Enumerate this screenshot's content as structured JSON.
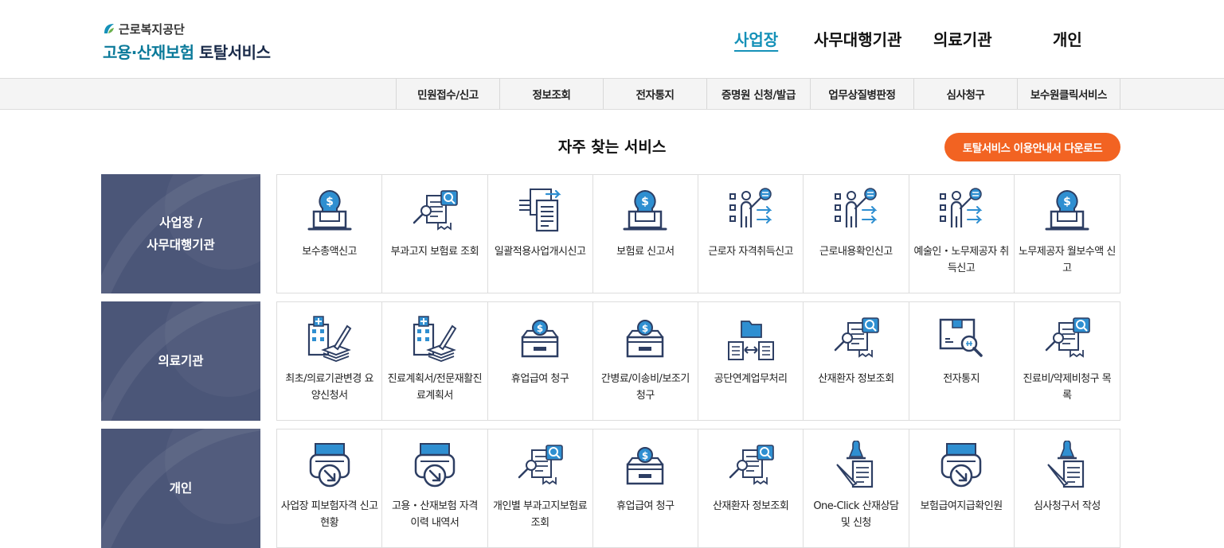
{
  "header": {
    "org": "근로복지공단",
    "title_part1": "고용·산재보험",
    "title_part2": "토탈서비스",
    "nav": [
      {
        "label": "사업장",
        "active": true
      },
      {
        "label": "사무대행기관",
        "active": false
      },
      {
        "label": "의료기관",
        "active": false
      },
      {
        "label": "개인",
        "active": false
      }
    ]
  },
  "subnav": [
    "민원접수/신고",
    "정보조회",
    "전자통지",
    "증명원 신청/발급",
    "업무상질병판정",
    "심사청구",
    "보수원클릭서비스"
  ],
  "section_title": "자주 찾는 서비스",
  "download_label": "토탈서비스 이용안내서 다운로드",
  "colors": {
    "accent": "#1591b8",
    "brand_dark": "#1a2b4a",
    "orange": "#f26322",
    "label_bg": "#4b5678",
    "icon_navy": "#2d3e63",
    "icon_blue": "#2f8fd1"
  },
  "rows": [
    {
      "label_line1": "사업장 /",
      "label_line2": "사무대행기관",
      "items": [
        {
          "label": "보수총액신고",
          "icon": "money-laptop-icon"
        },
        {
          "label": "부과고지 보험료 조회",
          "icon": "document-search-icon"
        },
        {
          "label": "일괄적용사업개시신고",
          "icon": "document-transfer-icon"
        },
        {
          "label": "보험료 신고서",
          "icon": "money-laptop-icon"
        },
        {
          "label": "근로자 자격취득신고",
          "icon": "presenter-checklist-icon"
        },
        {
          "label": "근로내용확인신고",
          "icon": "presenter-checklist-icon"
        },
        {
          "label": "예술인・노무제공자 취득신고",
          "icon": "presenter-checklist-icon"
        },
        {
          "label": "노무제공자 월보수액 신고",
          "icon": "money-laptop-icon"
        }
      ]
    },
    {
      "label_line1": "의료기관",
      "label_line2": "",
      "items": [
        {
          "label": "최초/의료기관변경 요양신청서",
          "icon": "hospital-document-icon"
        },
        {
          "label": "진료계획서/전문재활진료계획서",
          "icon": "hospital-document-icon"
        },
        {
          "label": "휴업급여 청구",
          "icon": "money-box-icon"
        },
        {
          "label": "간병료/이송비/보조기 청구",
          "icon": "money-box-icon"
        },
        {
          "label": "공단연계업무처리",
          "icon": "folder-exchange-icon"
        },
        {
          "label": "산재환자 정보조회",
          "icon": "document-search-icon"
        },
        {
          "label": "전자통지",
          "icon": "package-search-icon"
        },
        {
          "label": "진료비/약제비청구 목록",
          "icon": "document-search-icon"
        }
      ]
    },
    {
      "label_line1": "개인",
      "label_line2": "",
      "items": [
        {
          "label": "사업장 피보험자격 신고현황",
          "icon": "printer-download-icon"
        },
        {
          "label": "고용・산재보험 자격 이력 내역서",
          "icon": "printer-download-icon"
        },
        {
          "label": "개인별 부과고지보험료 조회",
          "icon": "document-search-icon"
        },
        {
          "label": "휴업급여 청구",
          "icon": "money-box-icon"
        },
        {
          "label": "산재환자 정보조회",
          "icon": "document-search-icon"
        },
        {
          "label": "One-Click 산재상담 및 신청",
          "icon": "stamp-document-icon"
        },
        {
          "label": "보험급여지급확인원",
          "icon": "printer-download-icon"
        },
        {
          "label": "심사청구서 작성",
          "icon": "stamp-document-icon"
        }
      ]
    }
  ]
}
